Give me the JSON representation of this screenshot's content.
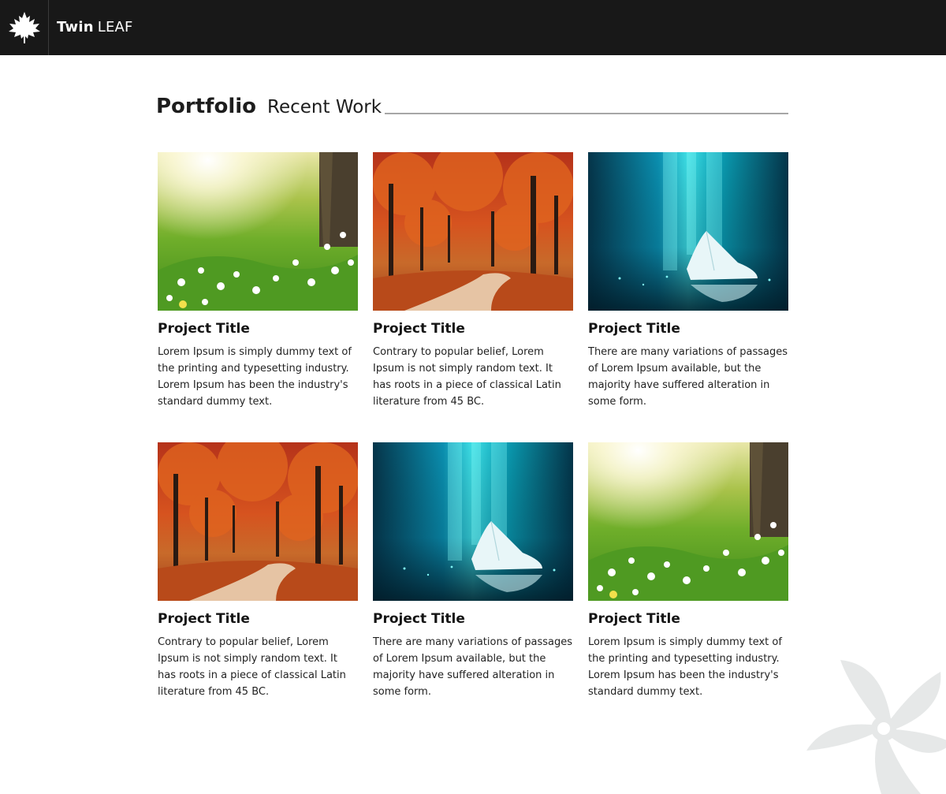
{
  "header": {
    "logo_icon": "maple-leaf-icon",
    "brand_first": "Twin",
    "brand_second": "LEAF"
  },
  "portfolio": {
    "title": "Portfolio",
    "subtitle": "Recent Work"
  },
  "projects": [
    {
      "image": "sunny-meadow-flowers",
      "title": "Project Title",
      "description": "Lorem Ipsum is simply dummy text of the printing and typesetting industry. Lorem Ipsum has been the industry's standard dummy text."
    },
    {
      "image": "autumn-forest-path",
      "title": "Project Title",
      "description": "Contrary to popular belief, Lorem Ipsum is not simply random text. It has roots in a piece of classical Latin literature from 45 BC."
    },
    {
      "image": "glowing-leaf-on-water",
      "title": "Project Title",
      "description": "There are many variations of passages of Lorem Ipsum available, but the majority have suffered alteration in some form."
    },
    {
      "image": "autumn-forest-path",
      "title": "Project Title",
      "description": "Contrary to popular belief, Lorem Ipsum is not simply random text. It has roots in a piece of classical Latin literature from 45 BC."
    },
    {
      "image": "glowing-leaf-on-water",
      "title": "Project Title",
      "description": "There are many variations of passages of Lorem Ipsum available, but the majority have suffered alteration in some form."
    },
    {
      "image": "sunny-meadow-flowers",
      "title": "Project Title",
      "description": "Lorem Ipsum is simply dummy text of the printing and typesetting industry. Lorem Ipsum has been the industry's standard dummy text."
    }
  ],
  "decor": {
    "corner_icon": "flower-watermark-icon"
  },
  "colors": {
    "header_bg": "#181818",
    "page_bg": "#ffffff",
    "rule": "#a6a6a6",
    "watermark": "#e6e8e8"
  }
}
